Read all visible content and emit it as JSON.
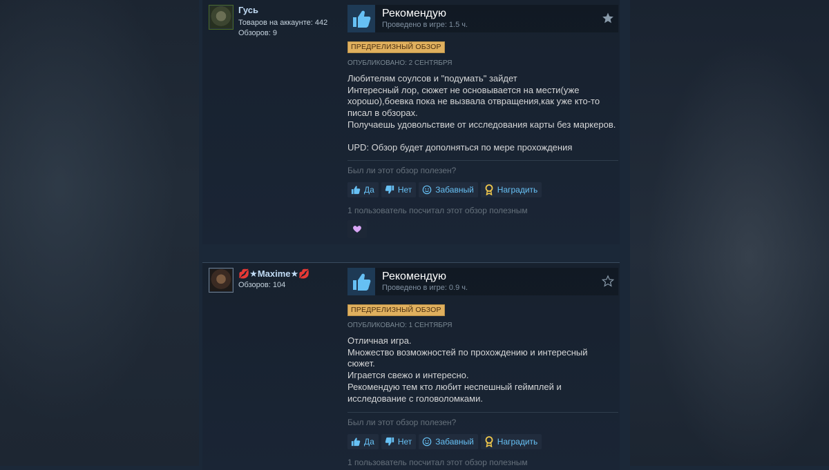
{
  "reviews": [
    {
      "author": {
        "name": "Гусь",
        "stats": [
          "Товаров на аккаунте: 442",
          "Обзоров: 9"
        ]
      },
      "verdict": "Рекомендую",
      "hours": "Проведено в игре: 1.5 ч.",
      "starred": true,
      "badge": "ПРЕДРЕЛИЗНЫЙ ОБЗОР",
      "posted": "ОПУБЛИКОВАНО: 2 СЕНТЯБРЯ",
      "lines": [
        "Любителям соулсов и \"подумать\" зайдет",
        "Интересный лор, сюжет не основывается на мести(уже",
        "хорошо),боевка пока не вызвала отвращения,как уже кто-то",
        "писал в обзорах.",
        "Получаешь удовольствие от исследования карты без маркеров.",
        "",
        "UPD: Обзор будет дополняться по мере прохождения"
      ],
      "helpful_question": "Был ли этот обзор полезен?",
      "buttons": {
        "yes": "Да",
        "no": "Нет",
        "funny": "Забавный",
        "award": "Наградить"
      },
      "helpful_count": "1 пользователь посчитал этот обзор полезным",
      "award_icon": "purple-heart-award-icon"
    },
    {
      "author": {
        "name": "💋★Maxime★💋",
        "stats": [
          "Обзоров: 104"
        ]
      },
      "verdict": "Рекомендую",
      "hours": "Проведено в игре: 0.9 ч.",
      "starred": false,
      "badge": "ПРЕДРЕЛИЗНЫЙ ОБЗОР",
      "posted": "ОПУБЛИКОВАНО: 1 СЕНТЯБРЯ",
      "lines": [
        "Отличная игра.",
        "Множество возможностей по прохождению и интересный",
        "сюжет.",
        "Играется свежо и интересно.",
        "Рекомендую тем кто любит неспешный геймплей и",
        "исследование с головоломками."
      ],
      "helpful_question": "Был ли этот обзор полезен?",
      "buttons": {
        "yes": "Да",
        "no": "Нет",
        "funny": "Забавный",
        "award": "Наградить"
      },
      "helpful_count": "1 пользователь посчитал этот обзор полезным"
    }
  ],
  "colors": {
    "page_bg": "#1b2838",
    "link_blue": "#67c1f5",
    "author_name": "#c1dbf4",
    "badge_bg": "#e0b05e"
  }
}
